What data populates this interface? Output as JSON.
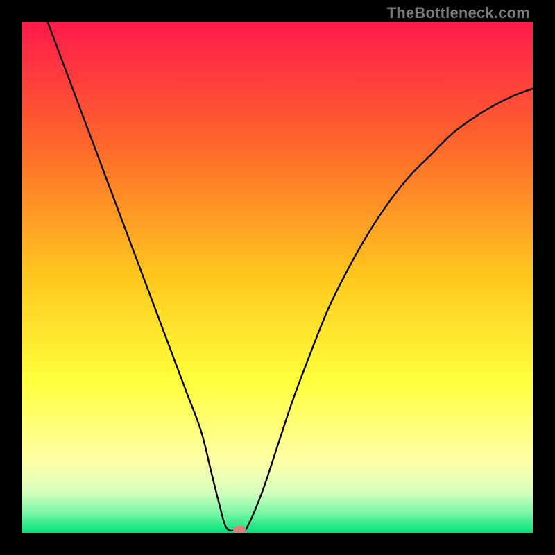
{
  "watermark": {
    "text": "TheBottleneck.com"
  },
  "chart_data": {
    "type": "line",
    "title": "",
    "xlabel": "",
    "ylabel": "",
    "xlim": [
      0,
      100
    ],
    "ylim": [
      0,
      100
    ],
    "grid": false,
    "legend": false,
    "background_gradient_stops": [
      {
        "pos": 0.0,
        "color": "#ff1a4b"
      },
      {
        "pos": 0.25,
        "color": "#ff6a2a"
      },
      {
        "pos": 0.5,
        "color": "#ffc81e"
      },
      {
        "pos": 0.7,
        "color": "#ffff3a"
      },
      {
        "pos": 0.86,
        "color": "#ffffa8"
      },
      {
        "pos": 0.92,
        "color": "#d7ffbe"
      },
      {
        "pos": 0.96,
        "color": "#7cf7a6"
      },
      {
        "pos": 1.0,
        "color": "#00e17a"
      }
    ],
    "series": [
      {
        "name": "bottleneck-curve",
        "color": "#000000",
        "x": [
          5,
          8,
          11,
          14,
          17,
          20,
          23,
          26,
          29,
          32,
          35,
          37,
          38.5,
          40,
          42,
          43,
          44,
          47,
          50,
          53,
          56,
          60,
          64,
          68,
          72,
          76,
          80,
          84,
          88,
          92,
          96,
          100
        ],
        "y": [
          100,
          92,
          84,
          76,
          68,
          60,
          52,
          44,
          36,
          28,
          20,
          12,
          6,
          1,
          0.5,
          0.5,
          1,
          8,
          17,
          26,
          34,
          44,
          52,
          59,
          65,
          70,
          74,
          78,
          81,
          83.5,
          85.5,
          87
        ]
      }
    ],
    "markers": [
      {
        "name": "min-marker",
        "x": 42.5,
        "y": 0.5,
        "color": "#d9807c"
      }
    ]
  }
}
